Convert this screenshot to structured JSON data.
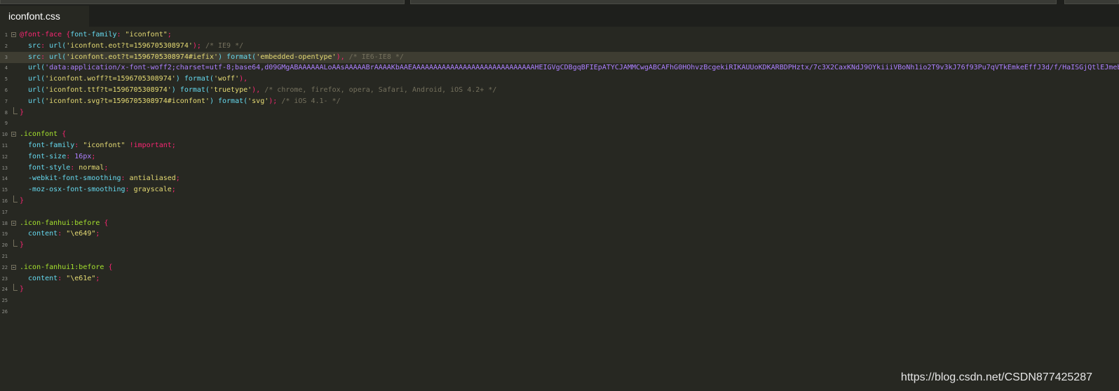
{
  "tab": {
    "title": "iconfont.css"
  },
  "colors": {
    "background": "#272822",
    "tab_bar": "#1e1f1c",
    "line_number": "#8f908a",
    "highlight_line": "#3e3d32",
    "default": "#f8f8f2",
    "keyword": "#f92672",
    "property": "#66d9ef",
    "string": "#e6db74",
    "function": "#66d9ef",
    "comment": "#75715e",
    "number": "#ae81ff",
    "selector": "#a6e22e",
    "base64": "#ae81ff"
  },
  "lines": [
    {
      "n": "1",
      "fold": "start",
      "tokens": [
        [
          "@font-face",
          "kw"
        ],
        [
          " {",
          "kw"
        ],
        [
          "font-family",
          "prop"
        ],
        [
          ": ",
          "kw"
        ],
        [
          "\"iconfont\"",
          "str"
        ],
        [
          ";",
          "kw"
        ]
      ]
    },
    {
      "n": "2",
      "tokens": [
        [
          "  src",
          "prop"
        ],
        [
          ": ",
          "kw"
        ],
        [
          "url(",
          "fn"
        ],
        [
          "'iconfont.eot?t=1596705308974'",
          "str"
        ],
        [
          ");",
          "kw"
        ],
        [
          " /* IE9 */",
          "cm"
        ]
      ]
    },
    {
      "n": "3",
      "highlight": true,
      "tokens": [
        [
          "  src",
          "prop"
        ],
        [
          ": ",
          "kw"
        ],
        [
          "url(",
          "fn"
        ],
        [
          "'iconfont.eot?t=1596705308974#iefix'",
          "str"
        ],
        [
          ") ",
          "fn"
        ],
        [
          "format(",
          "fn"
        ],
        [
          "'embedded-opentype'",
          "str"
        ],
        [
          "),",
          "kw"
        ],
        [
          " /* IE6-IE8 */",
          "cm"
        ]
      ]
    },
    {
      "n": "4",
      "tokens": [
        [
          "  url(",
          "fn"
        ],
        [
          "'data:application/x-font-woff2;charset=utf-8;base64,d09GMgABAAAAAALoAAsAAAAABrAAAAKbAAEAAAAAAAAAAAAAAAAAAAAAAAAAAAAAHEIGVgCDBgqBFIEpATYCJAMMCwgABCAFhG0HOhvzBcgekiRIKAUUoKDKARBDPHztx/7c3X2CaxKNdJ9OYkiiiVBoNh1io2T9v3kJ76f93Pu7qVTkEmkeEffJ3d/f/HaISGjQtlEJmeb",
          "b64"
        ]
      ]
    },
    {
      "n": "5",
      "tokens": [
        [
          "  url(",
          "fn"
        ],
        [
          "'iconfont.woff?t=1596705308974'",
          "str"
        ],
        [
          ") ",
          "fn"
        ],
        [
          "format(",
          "fn"
        ],
        [
          "'woff'",
          "str"
        ],
        [
          "),",
          "kw"
        ]
      ]
    },
    {
      "n": "6",
      "tokens": [
        [
          "  url(",
          "fn"
        ],
        [
          "'iconfont.ttf?t=1596705308974'",
          "str"
        ],
        [
          ") ",
          "fn"
        ],
        [
          "format(",
          "fn"
        ],
        [
          "'truetype'",
          "str"
        ],
        [
          "),",
          "kw"
        ],
        [
          " /* chrome, firefox, opera, Safari, Android, iOS 4.2+ */",
          "cm"
        ]
      ]
    },
    {
      "n": "7",
      "tokens": [
        [
          "  url(",
          "fn"
        ],
        [
          "'iconfont.svg?t=1596705308974#iconfont'",
          "str"
        ],
        [
          ") ",
          "fn"
        ],
        [
          "format(",
          "fn"
        ],
        [
          "'svg'",
          "str"
        ],
        [
          ");",
          "kw"
        ],
        [
          " /* iOS 4.1- */",
          "cm"
        ]
      ]
    },
    {
      "n": "8",
      "fold": "end",
      "tokens": [
        [
          "}",
          "kw"
        ]
      ]
    },
    {
      "n": "9",
      "tokens": []
    },
    {
      "n": "10",
      "fold": "start",
      "tokens": [
        [
          ".iconfont",
          "sel"
        ],
        [
          " {",
          "kw"
        ]
      ]
    },
    {
      "n": "11",
      "tokens": [
        [
          "  font-family",
          "prop"
        ],
        [
          ": ",
          "kw"
        ],
        [
          "\"iconfont\"",
          "str"
        ],
        [
          " !important",
          "kw"
        ],
        [
          ";",
          "kw"
        ]
      ]
    },
    {
      "n": "12",
      "tokens": [
        [
          "  font-size",
          "prop"
        ],
        [
          ": ",
          "kw"
        ],
        [
          "16px",
          "num"
        ],
        [
          ";",
          "kw"
        ]
      ]
    },
    {
      "n": "13",
      "tokens": [
        [
          "  font-style",
          "prop"
        ],
        [
          ": ",
          "kw"
        ],
        [
          "normal",
          "str"
        ],
        [
          ";",
          "kw"
        ]
      ]
    },
    {
      "n": "14",
      "tokens": [
        [
          "  -webkit-font-smoothing",
          "prop"
        ],
        [
          ": ",
          "kw"
        ],
        [
          "antialiased",
          "str"
        ],
        [
          ";",
          "kw"
        ]
      ]
    },
    {
      "n": "15",
      "tokens": [
        [
          "  -moz-osx-font-smoothing",
          "prop"
        ],
        [
          ": ",
          "kw"
        ],
        [
          "grayscale",
          "str"
        ],
        [
          ";",
          "kw"
        ]
      ]
    },
    {
      "n": "16",
      "fold": "end",
      "tokens": [
        [
          "}",
          "kw"
        ]
      ]
    },
    {
      "n": "17",
      "tokens": []
    },
    {
      "n": "18",
      "fold": "start",
      "tokens": [
        [
          ".icon-fanhui",
          "sel"
        ],
        [
          ":before",
          "sel2"
        ],
        [
          " {",
          "kw"
        ]
      ]
    },
    {
      "n": "19",
      "tokens": [
        [
          "  content",
          "prop"
        ],
        [
          ": ",
          "kw"
        ],
        [
          "\"\\e649\"",
          "str"
        ],
        [
          ";",
          "kw"
        ]
      ]
    },
    {
      "n": "20",
      "fold": "end",
      "tokens": [
        [
          "}",
          "kw"
        ]
      ]
    },
    {
      "n": "21",
      "tokens": []
    },
    {
      "n": "22",
      "fold": "start",
      "tokens": [
        [
          ".icon-fanhui1",
          "sel"
        ],
        [
          ":before",
          "sel2"
        ],
        [
          " {",
          "kw"
        ]
      ]
    },
    {
      "n": "23",
      "tokens": [
        [
          "  content",
          "prop"
        ],
        [
          ": ",
          "kw"
        ],
        [
          "\"\\e61e\"",
          "str"
        ],
        [
          ";",
          "kw"
        ]
      ]
    },
    {
      "n": "24",
      "fold": "end",
      "tokens": [
        [
          "}",
          "kw"
        ]
      ]
    },
    {
      "n": "25",
      "tokens": []
    },
    {
      "n": "26",
      "tokens": []
    }
  ],
  "watermark": "https://blog.csdn.net/CSDN877425287"
}
